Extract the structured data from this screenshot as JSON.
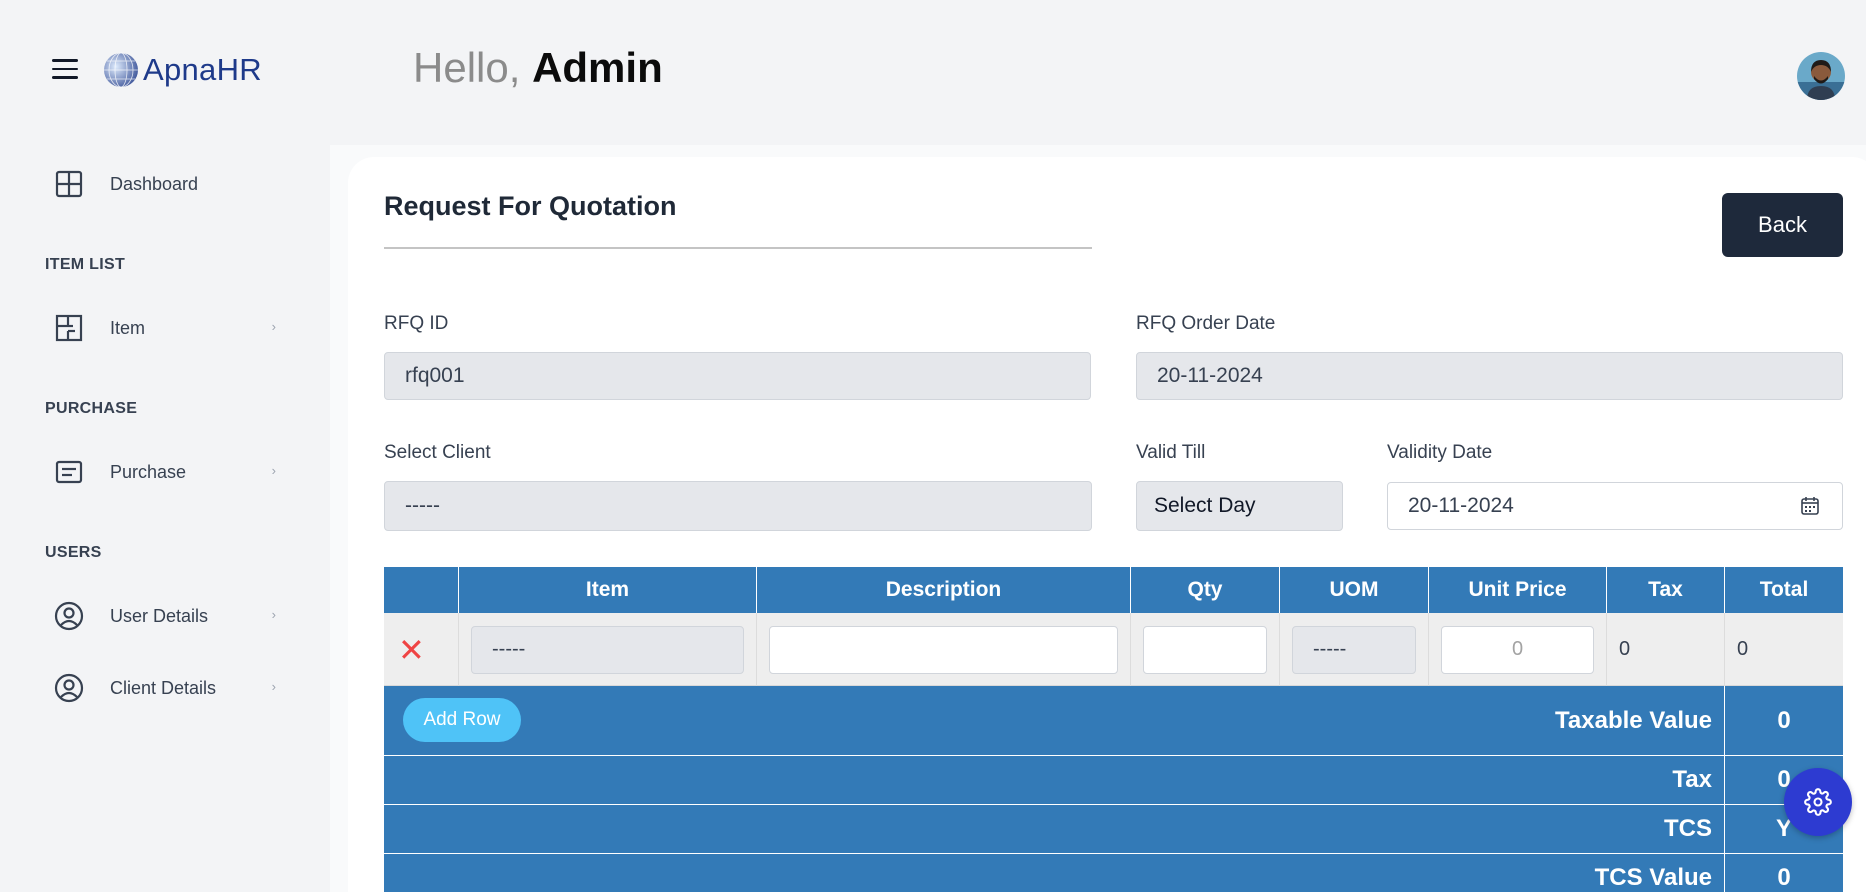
{
  "header": {
    "app_name": "ApnaHR",
    "greeting_prefix": "Hello,",
    "user_name": "Admin"
  },
  "sidebar": {
    "dashboard": "Dashboard",
    "sections": [
      {
        "title": "ITEM LIST",
        "items": [
          {
            "label": "Item",
            "icon": "floorplan-icon"
          }
        ]
      },
      {
        "title": "PURCHASE",
        "items": [
          {
            "label": "Purchase",
            "icon": "document-icon"
          }
        ]
      },
      {
        "title": "USERS",
        "items": [
          {
            "label": "User Details",
            "icon": "user-circle-icon"
          },
          {
            "label": "Client Details",
            "icon": "user-circle-icon"
          }
        ]
      }
    ],
    "chevron": "›"
  },
  "page": {
    "title": "Request For Quotation",
    "back_label": "Back"
  },
  "form": {
    "rfq_id_label": "RFQ ID",
    "rfq_id_value": "rfq001",
    "rfq_date_label": "RFQ Order Date",
    "rfq_date_value": "20-11-2024",
    "client_label": "Select Client",
    "client_value": "-----",
    "valid_till_label": "Valid Till",
    "valid_till_value": "Select Day",
    "validity_date_label": "Validity Date",
    "validity_date_value": "20-11-2024"
  },
  "table": {
    "headers": [
      "",
      "Item",
      "Description",
      "Qty",
      "UOM",
      "Unit Price",
      "Tax",
      "Total"
    ],
    "row": {
      "item": "-----",
      "description": "",
      "qty": "",
      "uom": "-----",
      "unit_price_placeholder": "0",
      "tax": "0",
      "total": "0"
    },
    "add_row_label": "Add Row",
    "summary": [
      {
        "label": "Taxable Value",
        "value": "0"
      },
      {
        "label": "Tax",
        "value": "0"
      },
      {
        "label": "TCS",
        "value": "Y"
      },
      {
        "label": "TCS Value",
        "value": "0"
      }
    ]
  },
  "colors": {
    "table_blue": "#337ab7",
    "back_button": "#1e293b",
    "add_row": "#4fc3f7",
    "fab": "#2d3bd1"
  }
}
